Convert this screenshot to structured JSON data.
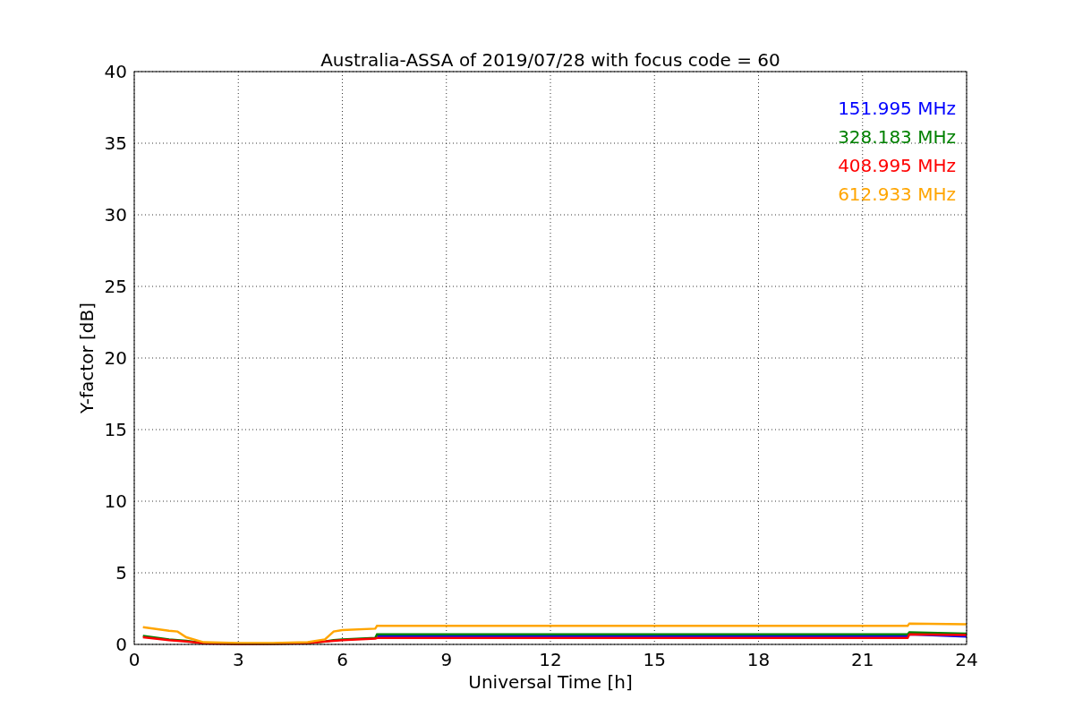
{
  "figure": {
    "chart_data": {
      "type": "line",
      "title": "Australia-ASSA of 2019/07/28 with focus code = 60",
      "xlabel": "Universal Time [h]",
      "ylabel": "Y-factor [dB]",
      "x": [
        0.25,
        1,
        1.25,
        1.5,
        2,
        3,
        4,
        5,
        5.5,
        5.75,
        6,
        6.95,
        7,
        22.3,
        22.35,
        24
      ],
      "series": [
        {
          "name": "151.995 MHz",
          "color": "#0000ff",
          "values": [
            null,
            null,
            null,
            null,
            null,
            null,
            null,
            null,
            null,
            null,
            null,
            null,
            0.55,
            0.55,
            0.7,
            0.55
          ]
        },
        {
          "name": "328.183 MHz",
          "color": "#008000",
          "values": [
            0.6,
            0.35,
            0.3,
            0.25,
            0.1,
            0.05,
            0.05,
            0.1,
            0.2,
            0.3,
            0.35,
            0.45,
            0.7,
            0.7,
            0.85,
            0.75
          ]
        },
        {
          "name": "408.995 MHz",
          "color": "#ff0000",
          "values": [
            0.5,
            0.3,
            0.25,
            0.2,
            0.08,
            0.03,
            0.05,
            0.1,
            0.2,
            0.25,
            0.3,
            0.4,
            0.45,
            0.45,
            0.7,
            0.65
          ]
        },
        {
          "name": "612.933 MHz",
          "color": "#ffa500",
          "values": [
            1.2,
            0.95,
            0.9,
            0.5,
            0.15,
            0.1,
            0.1,
            0.15,
            0.35,
            0.9,
            1.0,
            1.1,
            1.3,
            1.3,
            1.45,
            1.4
          ]
        }
      ],
      "grid": true,
      "xlim": [
        0,
        24
      ],
      "ylim": [
        0,
        40
      ],
      "xticks": [
        0,
        3,
        6,
        9,
        12,
        15,
        18,
        21,
        24
      ],
      "yticks": [
        0,
        5,
        10,
        15,
        20,
        25,
        30,
        35,
        40
      ]
    }
  }
}
